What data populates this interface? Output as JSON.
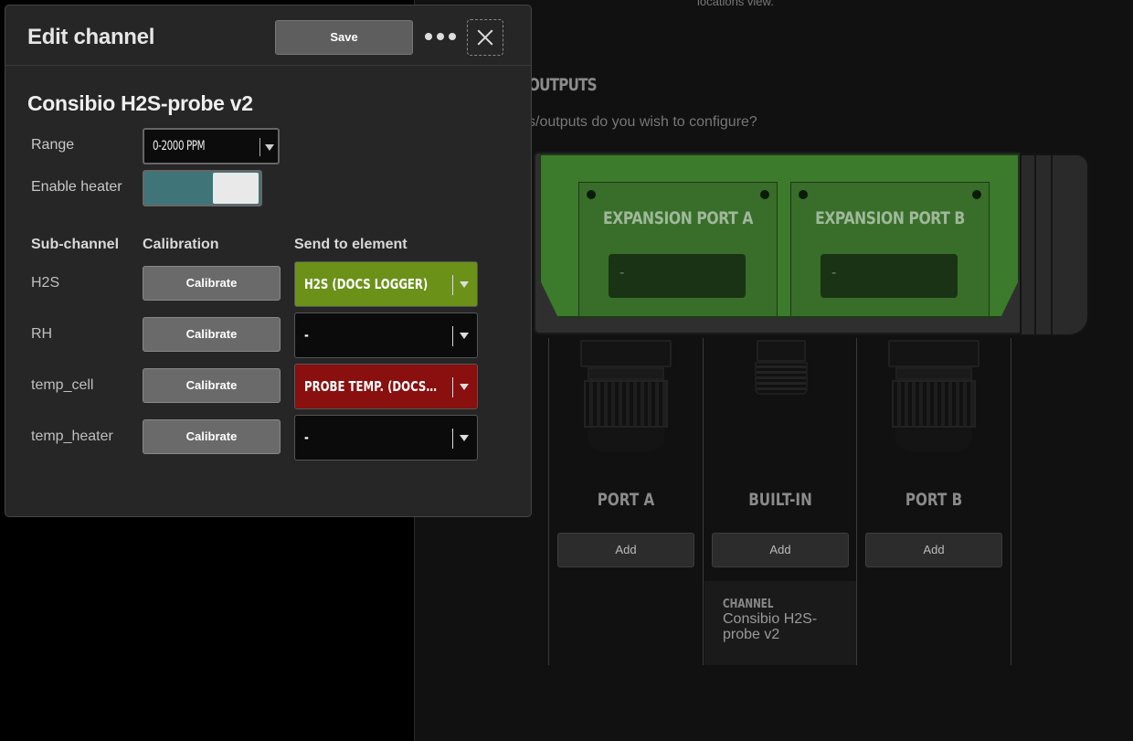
{
  "background": {
    "note": "locations view.",
    "heading": "OUTPUTS",
    "question": "s/outputs do you wish to configure?",
    "expansion_ports": [
      {
        "title": "EXPANSION PORT A",
        "slot_value": "-"
      },
      {
        "title": "EXPANSION PORT B",
        "slot_value": "-"
      }
    ],
    "ports": [
      {
        "title": "PORT A",
        "add_label": "Add"
      },
      {
        "title": "BUILT-IN",
        "add_label": "Add"
      },
      {
        "title": "PORT B",
        "add_label": "Add"
      }
    ],
    "channel_card": {
      "caption": "CHANNEL",
      "value": "Consibio H2S-probe v2"
    },
    "colors": {
      "device_green": "#3c7a2c",
      "panel_bg": "#111111"
    }
  },
  "dialog": {
    "title": "Edit channel",
    "save_label": "Save",
    "more_icon": "more-horizontal-icon",
    "close_icon": "close-icon",
    "probe_title": "Consibio H2S-probe v2",
    "range_label": "Range",
    "range_value": "0-2000 PPM",
    "heater_label": "Enable heater",
    "heater_enabled": true,
    "table": {
      "headers": [
        "Sub-channel",
        "Calibration",
        "Send to element"
      ],
      "rows": [
        {
          "sub_channel": "H2S",
          "calibrate_label": "Calibrate",
          "send_to": "H2S (DOCS LOGGER)",
          "send_color": "#6b9119"
        },
        {
          "sub_channel": "RH",
          "calibrate_label": "Calibrate",
          "send_to": "-",
          "send_color": "#0b0b0b"
        },
        {
          "sub_channel": "temp_cell",
          "calibrate_label": "Calibrate",
          "send_to": "PROBE TEMP. (DOCS LOGGER)",
          "send_color": "#8a0f0f"
        },
        {
          "sub_channel": "temp_heater",
          "calibrate_label": "Calibrate",
          "send_to": "-",
          "send_color": "#0b0b0b"
        }
      ]
    },
    "colors": {
      "toggle_on": "#3f7478",
      "dialog_bg": "#262626"
    }
  }
}
